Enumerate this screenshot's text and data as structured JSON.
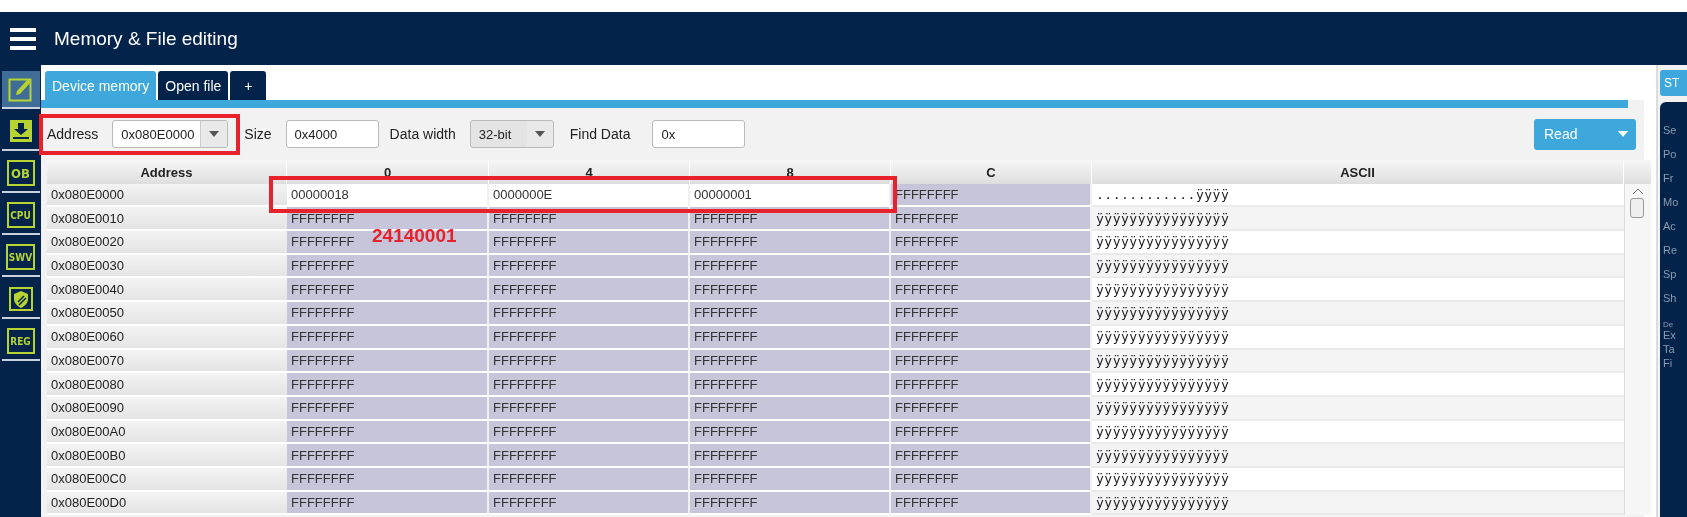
{
  "header": {
    "title": "Memory & File editing"
  },
  "sidebar": {
    "items": [
      {
        "kind": "edit",
        "selected": true
      },
      {
        "kind": "download",
        "selected": false
      },
      {
        "kind": "text",
        "label": "OB",
        "selected": false
      },
      {
        "kind": "text",
        "label": "CPU",
        "selected": false
      },
      {
        "kind": "text",
        "label": "SWV",
        "selected": false
      },
      {
        "kind": "shield",
        "selected": false
      },
      {
        "kind": "text",
        "label": "REG",
        "selected": false
      }
    ]
  },
  "tabs": [
    {
      "label": "Device memory",
      "selected": true
    },
    {
      "label": "Open file",
      "selected": false
    },
    {
      "label": "+",
      "selected": false
    }
  ],
  "toolbar": {
    "address": {
      "label": "Address",
      "value": "0x080E0000",
      "highlighted": true
    },
    "size": {
      "label": "Size",
      "value": "0x4000"
    },
    "data_width": {
      "label": "Data width",
      "value": "32-bit"
    },
    "find_data": {
      "label": "Find Data",
      "value": "0x"
    },
    "read_button": "Read"
  },
  "table": {
    "columns": [
      "Address",
      "0",
      "4",
      "8",
      "C",
      "ASCII"
    ],
    "rows": [
      {
        "address": "0x080E0000",
        "highlighted": true,
        "cells": [
          {
            "value": "00000018",
            "edited": true
          },
          {
            "value": "0000000E",
            "edited": true
          },
          {
            "value": "00000001",
            "edited": true
          },
          {
            "value": "FFFFFFFF",
            "edited": false
          }
        ],
        "ascii": "............ÿÿÿÿ"
      },
      {
        "address": "0x080E0010",
        "highlighted": false,
        "cells": [
          {
            "value": "FFFFFFFF",
            "edited": false
          },
          {
            "value": "FFFFFFFF",
            "edited": false
          },
          {
            "value": "FFFFFFFF",
            "edited": false
          },
          {
            "value": "FFFFFFFF",
            "edited": false
          }
        ],
        "ascii": "ÿÿÿÿÿÿÿÿÿÿÿÿÿÿÿÿ"
      },
      {
        "address": "0x080E0020",
        "highlighted": false,
        "cells": [
          {
            "value": "FFFFFFFF",
            "edited": false
          },
          {
            "value": "FFFFFFFF",
            "edited": false
          },
          {
            "value": "FFFFFFFF",
            "edited": false
          },
          {
            "value": "FFFFFFFF",
            "edited": false
          }
        ],
        "ascii": "ÿÿÿÿÿÿÿÿÿÿÿÿÿÿÿÿ"
      },
      {
        "address": "0x080E0030",
        "highlighted": false,
        "cells": [
          {
            "value": "FFFFFFFF",
            "edited": false
          },
          {
            "value": "FFFFFFFF",
            "edited": false
          },
          {
            "value": "FFFFFFFF",
            "edited": false
          },
          {
            "value": "FFFFFFFF",
            "edited": false
          }
        ],
        "ascii": "ÿÿÿÿÿÿÿÿÿÿÿÿÿÿÿÿ"
      },
      {
        "address": "0x080E0040",
        "highlighted": false,
        "cells": [
          {
            "value": "FFFFFFFF",
            "edited": false
          },
          {
            "value": "FFFFFFFF",
            "edited": false
          },
          {
            "value": "FFFFFFFF",
            "edited": false
          },
          {
            "value": "FFFFFFFF",
            "edited": false
          }
        ],
        "ascii": "ÿÿÿÿÿÿÿÿÿÿÿÿÿÿÿÿ"
      },
      {
        "address": "0x080E0050",
        "highlighted": false,
        "cells": [
          {
            "value": "FFFFFFFF",
            "edited": false
          },
          {
            "value": "FFFFFFFF",
            "edited": false
          },
          {
            "value": "FFFFFFFF",
            "edited": false
          },
          {
            "value": "FFFFFFFF",
            "edited": false
          }
        ],
        "ascii": "ÿÿÿÿÿÿÿÿÿÿÿÿÿÿÿÿ"
      },
      {
        "address": "0x080E0060",
        "highlighted": false,
        "cells": [
          {
            "value": "FFFFFFFF",
            "edited": false
          },
          {
            "value": "FFFFFFFF",
            "edited": false
          },
          {
            "value": "FFFFFFFF",
            "edited": false
          },
          {
            "value": "FFFFFFFF",
            "edited": false
          }
        ],
        "ascii": "ÿÿÿÿÿÿÿÿÿÿÿÿÿÿÿÿ"
      },
      {
        "address": "0x080E0070",
        "highlighted": false,
        "cells": [
          {
            "value": "FFFFFFFF",
            "edited": false
          },
          {
            "value": "FFFFFFFF",
            "edited": false
          },
          {
            "value": "FFFFFFFF",
            "edited": false
          },
          {
            "value": "FFFFFFFF",
            "edited": false
          }
        ],
        "ascii": "ÿÿÿÿÿÿÿÿÿÿÿÿÿÿÿÿ"
      },
      {
        "address": "0x080E0080",
        "highlighted": false,
        "cells": [
          {
            "value": "FFFFFFFF",
            "edited": false
          },
          {
            "value": "FFFFFFFF",
            "edited": false
          },
          {
            "value": "FFFFFFFF",
            "edited": false
          },
          {
            "value": "FFFFFFFF",
            "edited": false
          }
        ],
        "ascii": "ÿÿÿÿÿÿÿÿÿÿÿÿÿÿÿÿ"
      },
      {
        "address": "0x080E0090",
        "highlighted": false,
        "cells": [
          {
            "value": "FFFFFFFF",
            "edited": false
          },
          {
            "value": "FFFFFFFF",
            "edited": false
          },
          {
            "value": "FFFFFFFF",
            "edited": false
          },
          {
            "value": "FFFFFFFF",
            "edited": false
          }
        ],
        "ascii": "ÿÿÿÿÿÿÿÿÿÿÿÿÿÿÿÿ"
      },
      {
        "address": "0x080E00A0",
        "highlighted": false,
        "cells": [
          {
            "value": "FFFFFFFF",
            "edited": false
          },
          {
            "value": "FFFFFFFF",
            "edited": false
          },
          {
            "value": "FFFFFFFF",
            "edited": false
          },
          {
            "value": "FFFFFFFF",
            "edited": false
          }
        ],
        "ascii": "ÿÿÿÿÿÿÿÿÿÿÿÿÿÿÿÿ"
      },
      {
        "address": "0x080E00B0",
        "highlighted": false,
        "cells": [
          {
            "value": "FFFFFFFF",
            "edited": false
          },
          {
            "value": "FFFFFFFF",
            "edited": false
          },
          {
            "value": "FFFFFFFF",
            "edited": false
          },
          {
            "value": "FFFFFFFF",
            "edited": false
          }
        ],
        "ascii": "ÿÿÿÿÿÿÿÿÿÿÿÿÿÿÿÿ"
      },
      {
        "address": "0x080E00C0",
        "highlighted": false,
        "cells": [
          {
            "value": "FFFFFFFF",
            "edited": false
          },
          {
            "value": "FFFFFFFF",
            "edited": false
          },
          {
            "value": "FFFFFFFF",
            "edited": false
          },
          {
            "value": "FFFFFFFF",
            "edited": false
          }
        ],
        "ascii": "ÿÿÿÿÿÿÿÿÿÿÿÿÿÿÿÿ"
      },
      {
        "address": "0x080E00D0",
        "highlighted": false,
        "cells": [
          {
            "value": "FFFFFFFF",
            "edited": false
          },
          {
            "value": "FFFFFFFF",
            "edited": false
          },
          {
            "value": "FFFFFFFF",
            "edited": false
          },
          {
            "value": "FFFFFFFF",
            "edited": false
          }
        ],
        "ascii": "ÿÿÿÿÿÿÿÿÿÿÿÿÿÿÿÿ"
      }
    ],
    "annotation": "24140001"
  },
  "right_panel": {
    "button": "ST",
    "labels": [
      "Se",
      "Po",
      "Fr",
      "Mo",
      "Ac",
      "Re",
      "Sp",
      "Sh"
    ],
    "small_label": "De",
    "lines": [
      "Ex",
      "Ta",
      "Fi"
    ]
  }
}
